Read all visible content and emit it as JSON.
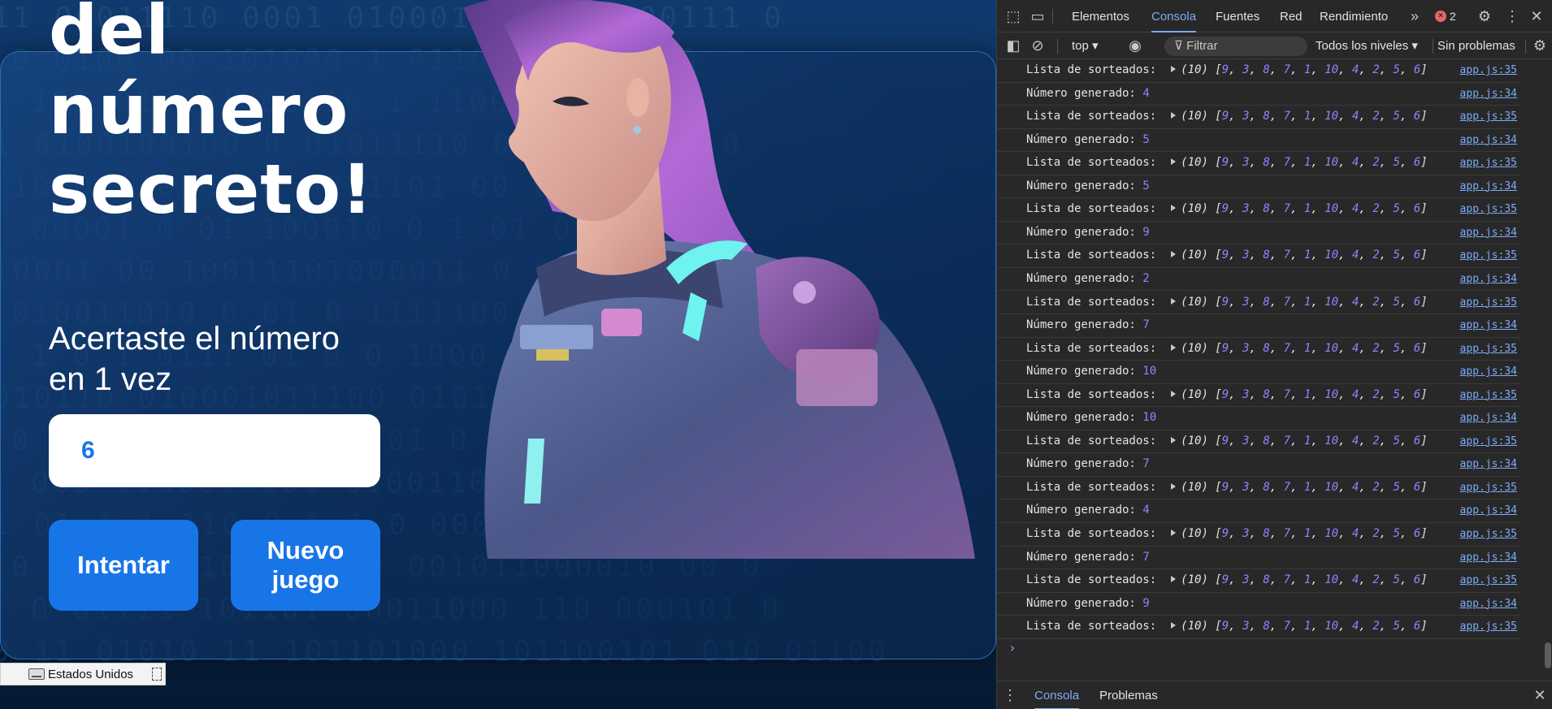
{
  "page": {
    "title_lines": [
      "del",
      "número",
      "secreto!"
    ],
    "message_lines": [
      "Acertaste el número",
      "en 1 vez"
    ],
    "input_value": "6",
    "buttons": {
      "try": "Intentar",
      "new_game_lines": [
        "Nuevo",
        "juego"
      ]
    },
    "binary_rows": [
      "11 00011110 0001 01000110 11 1000111 0",
      "0 0100 00 101000 1 0110 110 10 10",
      "101 01 101 00110 1 11001001 01",
      "1 0100100100 0 01011110 00 011 1 1 0",
      "10 0011000 10 0011101 00 0 1",
      "00001 0 01 100010 0 1 01 000010 1",
      "10001 00 10011101000011 0 011",
      "010011010 0 01 0 1111100 1 010000",
      "1 0 1 0111 01 0 0 1000 101 011",
      "010110 010001011100 0101000 1 1",
      "0 0 1 0 01 0110 1 01 0 10 0 1",
      "000 1100000101 0100110 0110 11 01 0",
      "1 01 1 1 110 0 1 1 0 000 110010 0",
      "0 10001001001110 0 001011000010 00 0",
      "0 01111 101101 00011000 110 000101 0",
      "0 11 01010 11 101101000 101100101 010 01100"
    ],
    "illustration_name": "woman-in-armor"
  },
  "taskbar": {
    "language": "Estados Unidos"
  },
  "devtools": {
    "tabs": [
      "Elementos",
      "Consola",
      "Fuentes",
      "Red",
      "Rendimiento"
    ],
    "active_tab": "Consola",
    "more_tabs_glyph": "»",
    "error_count": "2",
    "context": "top ▾",
    "filter_placeholder": "Filtrar",
    "levels": "Todos los niveles ▾",
    "issues": "Sin problemas",
    "drawer_tabs": [
      "Consola",
      "Problemas"
    ],
    "console": {
      "list_label": "Lista de sorteados:",
      "number_label": "Número generado:",
      "array_length": "(10)",
      "array": [
        9,
        3,
        8,
        7,
        1,
        10,
        4,
        2,
        5,
        6
      ],
      "src_list": "app.js:35",
      "src_number": "app.js:34",
      "generated_numbers": [
        4,
        5,
        5,
        9,
        2,
        7,
        10,
        10,
        7,
        4,
        7,
        9
      ],
      "prompt_glyph": "›"
    }
  },
  "colors": {
    "accent": "#1875e8",
    "devtools_bg": "#282828",
    "devtools_link": "#7cacf8",
    "console_number": "#9980ff"
  }
}
